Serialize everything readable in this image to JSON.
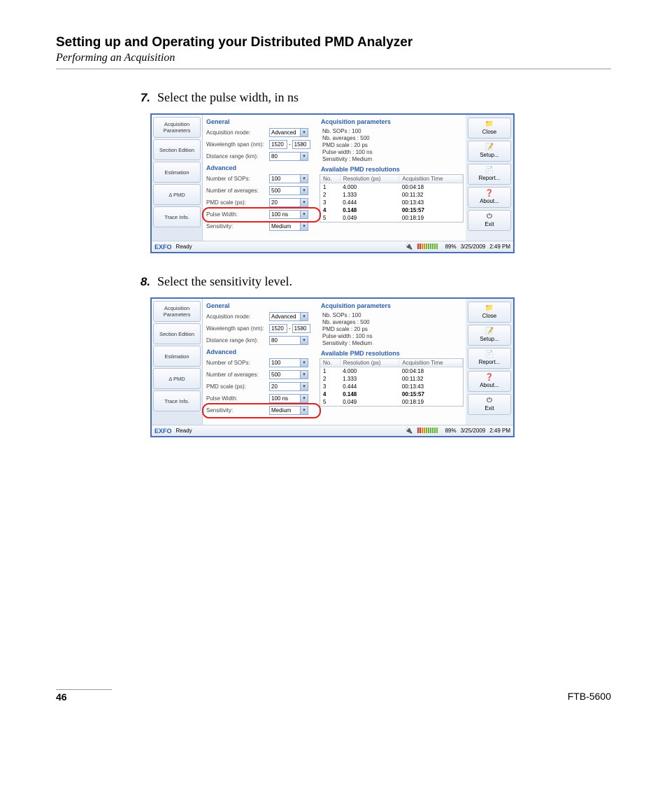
{
  "document": {
    "heading": "Setting up and Operating your Distributed PMD Analyzer",
    "subtitle": "Performing an Acquisition",
    "page_number": "46",
    "product_code": "FTB-5600"
  },
  "steps": [
    {
      "num": "7.",
      "text": "Select the pulse width, in ns",
      "highlight": "pulse_width"
    },
    {
      "num": "8.",
      "text": "Select the sensitivity level.",
      "highlight": "sensitivity"
    }
  ],
  "ui": {
    "sidebar": {
      "items": [
        "Acquisition Parameters",
        "Section Edition",
        "Estimation",
        "Δ PMD",
        "Trace Info."
      ]
    },
    "general": {
      "title": "General",
      "acquisition_mode_label": "Acquisition mode:",
      "acquisition_mode_value": "Advanced",
      "wavelength_label": "Wavelength span (nm):",
      "wavelength_from": "1520",
      "wavelength_to": "1580",
      "distance_label": "Distance range (km):",
      "distance_value": "80"
    },
    "advanced": {
      "title": "Advanced",
      "sops_label": "Number of SOPs:",
      "sops_value": "100",
      "avg_label": "Number of averages:",
      "avg_value": "500",
      "pmdscale_label": "PMD scale (ps):",
      "pmdscale_value": "20",
      "pulsewidth_label": "Pulse Width:",
      "pulsewidth_value": "100 ns",
      "sensitivity_label": "Sensitivity:",
      "sensitivity_value": "Medium"
    },
    "acq_params": {
      "title": "Acquisition parameters",
      "lines": [
        "Nb. SOPs : 100",
        "Nb. averages : 500",
        "PMD scale : 20 ps",
        "Pulse width : 100 ns",
        "Sensitivity : Medium"
      ]
    },
    "resolutions": {
      "title": "Available PMD resolutions",
      "columns": [
        "No.",
        "Resolution (ps)",
        "Acquisition Time"
      ],
      "rows": [
        {
          "no": "1",
          "res": "4.000",
          "time": "00:04:18",
          "sel": false
        },
        {
          "no": "2",
          "res": "1.333",
          "time": "00:11:32",
          "sel": false
        },
        {
          "no": "3",
          "res": "0.444",
          "time": "00:13:43",
          "sel": false
        },
        {
          "no": "4",
          "res": "0.148",
          "time": "00:15:57",
          "sel": true
        },
        {
          "no": "5",
          "res": "0.049",
          "time": "00:18:19",
          "sel": false
        }
      ]
    },
    "right_buttons": [
      {
        "icon": "📁",
        "label": "Close"
      },
      {
        "icon": "📝",
        "label": "Setup..."
      },
      {
        "icon": "📄",
        "label": "Report..."
      },
      {
        "icon": "❓",
        "label": "About..."
      },
      {
        "icon": "⏻",
        "label": "Exit"
      }
    ],
    "status": {
      "brand": "EXFO",
      "state": "Ready",
      "battery_pct": "89%",
      "date": "3/25/2009",
      "time": "2:49 PM"
    }
  }
}
